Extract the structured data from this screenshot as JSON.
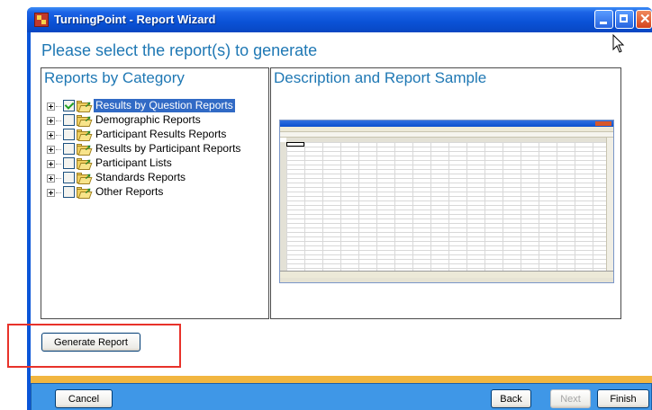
{
  "window": {
    "title": "TurningPoint - Report Wizard"
  },
  "heading": "Please select the report(s) to generate",
  "left_panel": {
    "title": "Reports by Category",
    "items": [
      {
        "label": "Results by Question Reports",
        "checked": true,
        "selected": true
      },
      {
        "label": "Demographic Reports",
        "checked": false,
        "selected": false
      },
      {
        "label": "Participant Results Reports",
        "checked": false,
        "selected": false
      },
      {
        "label": "Results by Participant Reports",
        "checked": false,
        "selected": false
      },
      {
        "label": "Participant Lists",
        "checked": false,
        "selected": false
      },
      {
        "label": "Standards Reports",
        "checked": false,
        "selected": false
      },
      {
        "label": "Other Reports",
        "checked": false,
        "selected": false
      }
    ]
  },
  "right_panel": {
    "title": "Description and Report Sample"
  },
  "buttons": {
    "generate": "Generate Report",
    "cancel": "Cancel",
    "back": "Back",
    "next": "Next",
    "finish": "Finish"
  },
  "colors": {
    "titlebar": "#0a52d6",
    "heading": "#1f78b4",
    "selection": "#316ac5",
    "highlight": "#e8322a",
    "footer": "#3f97e7"
  }
}
